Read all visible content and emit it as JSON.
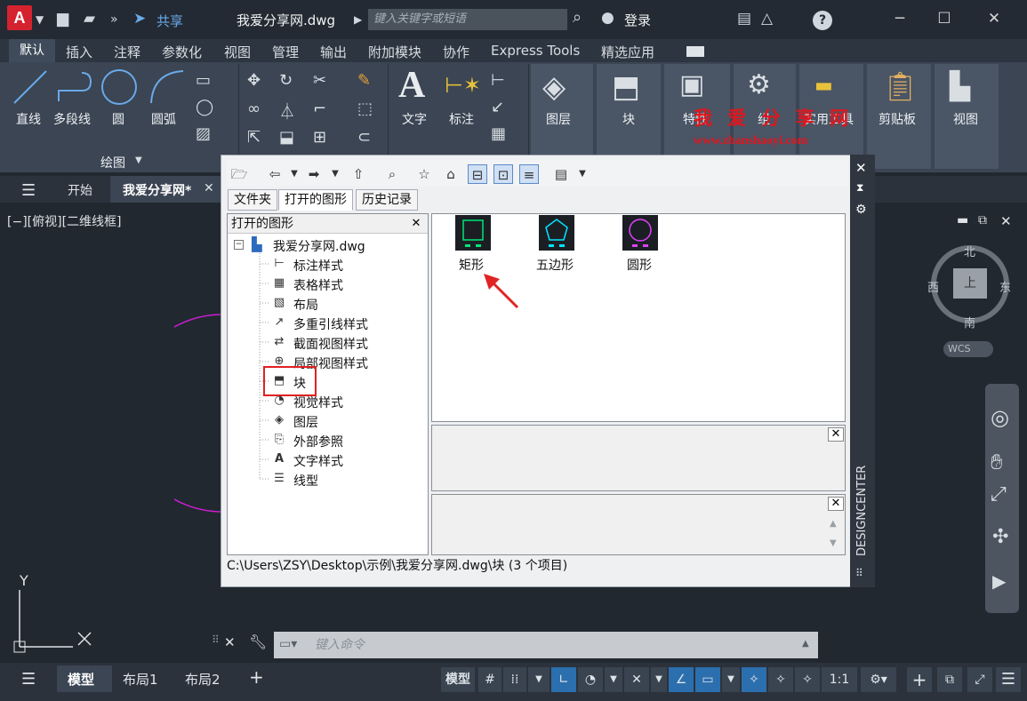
{
  "titlebar": {
    "logo": "A",
    "share_label": "共享",
    "doc_title": "我爱分享网.dwg",
    "search_placeholder": "键入关键字或短语",
    "login_label": "登录",
    "help_label": "?"
  },
  "menu": {
    "tabs": [
      "默认",
      "插入",
      "注释",
      "参数化",
      "视图",
      "管理",
      "输出",
      "附加模块",
      "协作",
      "Express Tools",
      "精选应用"
    ]
  },
  "ribbon": {
    "draw": [
      "直线",
      "多段线",
      "圆",
      "圆弧"
    ],
    "draw_panel_label": "绘图",
    "annotation": [
      "文字",
      "标注"
    ],
    "big_buttons": [
      "图层",
      "块",
      "特性",
      "组",
      "实用工具",
      "剪贴板",
      "视图"
    ]
  },
  "doctabs": {
    "start": "开始",
    "active": "我爱分享网*"
  },
  "viewport": {
    "label": "[−][俯视][二维线框]",
    "axis_y": "Y",
    "compass": {
      "n": "北",
      "s": "南",
      "e": "东",
      "w": "西",
      "center": "上"
    },
    "wcs": "WCS"
  },
  "design_center": {
    "tabs": [
      "文件夹",
      "打开的图形",
      "历史记录"
    ],
    "tree_title": "打开的图形",
    "root": "我爱分享网.dwg",
    "items": [
      "标注样式",
      "表格样式",
      "布局",
      "多重引线样式",
      "截面视图样式",
      "局部视图样式",
      "块",
      "视觉样式",
      "图层",
      "外部参照",
      "文字样式",
      "线型"
    ],
    "blocks": [
      {
        "label": "矩形",
        "color": "#00e676"
      },
      {
        "label": "五边形",
        "color": "#00e5ff"
      },
      {
        "label": "圆形",
        "color": "#e040fb"
      }
    ],
    "status": "C:\\Users\\ZSY\\Desktop\\示例\\我爱分享网.dwg\\块 (3 个项目)",
    "side_label": "DESIGNCENTER"
  },
  "watermark": {
    "line1": "我 爱 分 享 网",
    "line2": "www.zhanshaoyi.com"
  },
  "cmdline": {
    "placeholder": "键入命令"
  },
  "statusbar": {
    "tabs": [
      "模型",
      "布局1",
      "布局2"
    ],
    "model_btn": "模型",
    "scale": "1:1"
  }
}
